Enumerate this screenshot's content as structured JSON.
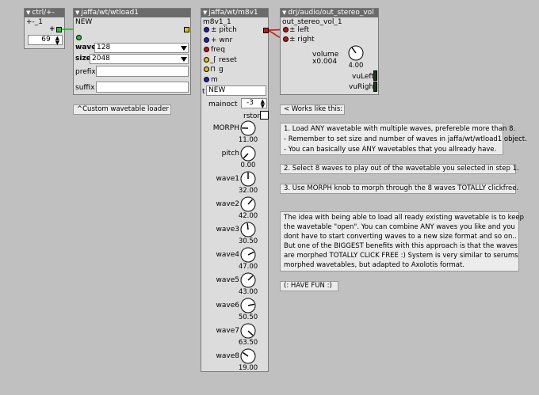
{
  "objects": {
    "ctrl": {
      "title": "ctrl/+-",
      "instance": "+-_1",
      "value": "69"
    },
    "wtload": {
      "title": "jaffa/wt/wtload1",
      "instance": "NEW",
      "waves_label": "waves",
      "waves_value": "128",
      "size_label": "size",
      "size_value": "2048",
      "prefix_label": "prefix",
      "prefix_value": "",
      "suffix_label": "suffix",
      "suffix_value": ""
    },
    "m8v1": {
      "title": "jaffa/wt/m8v1",
      "instance": "m8v1_1",
      "inlets": [
        {
          "label": "± pitch",
          "color": "blue"
        },
        {
          "label": "+ wnr",
          "color": "blue"
        },
        {
          "label": "freq",
          "color": "red"
        },
        {
          "label": "reset",
          "color": "yellow",
          "icon": "step-icon"
        },
        {
          "label": "g",
          "color": "yellow",
          "icon": "pulse-icon"
        },
        {
          "label": "m",
          "color": "blue"
        }
      ],
      "table_prefix": "t",
      "table_value": "NEW",
      "mainoct_label": "mainoct",
      "mainoct_value": "-3",
      "rston_label": "rston",
      "knobs": [
        {
          "label": "MORPH",
          "value": "11.00"
        },
        {
          "label": "pitch",
          "value": "0.00"
        },
        {
          "label": "wave1",
          "value": "32.00"
        },
        {
          "label": "wave2",
          "value": "42.00"
        },
        {
          "label": "wave3",
          "value": "30.50"
        },
        {
          "label": "wave4",
          "value": "47.00"
        },
        {
          "label": "wave5",
          "value": "43.00"
        },
        {
          "label": "wave6",
          "value": "50.50"
        },
        {
          "label": "wave7",
          "value": "63.50"
        },
        {
          "label": "wave8",
          "value": "19.00"
        }
      ]
    },
    "outvol": {
      "title": "drj/audio/out_stereo_vol",
      "instance": "out_stereo_vol_1",
      "left_label": "± left",
      "right_label": "± right",
      "volume_label": "volume",
      "volume_mult": "x0.004",
      "volume_value": "4.00",
      "vuleft_label": "vuLeft",
      "vuright_label": "vuRight"
    }
  },
  "notes": {
    "custom": "^Custom wavetable loader",
    "works": "< Works like this:",
    "step1": [
      "1. Load ANY wavetable with multiple waves, prefereble more than 8.",
      "- Remember to set size and number of waves in jaffa/wt/wtload1 object.",
      "- You can basically use ANY wavetables that you allready have."
    ],
    "step2": "2. Select 8 waves to play out of the wavetable you selected in step 1.",
    "step3": "3. Use MORPH knob to morph through the 8 waves TOTALLY clickfree.",
    "idea": [
      "The idea with being able to load all ready existing wavetable is to keep",
      "the wavetable \"open\". You can combine ANY waves you like and you",
      "dont have to start converting waves to a new size format and so on..",
      "But one of the BIGGEST benefits with this approach is that the waves",
      "are morphed TOTALLY CLICK FREE :) System is very similar to serums",
      "morphed wavetables, but adapted to Axolotis format."
    ],
    "fun": "(: HAVE FUN :)"
  },
  "colors": {
    "background": "#c0c0c0",
    "header": "#6b6b6b",
    "object_body": "#dcdcdc",
    "wire_green": "#22aa22",
    "wire_red": "#cc1111"
  }
}
